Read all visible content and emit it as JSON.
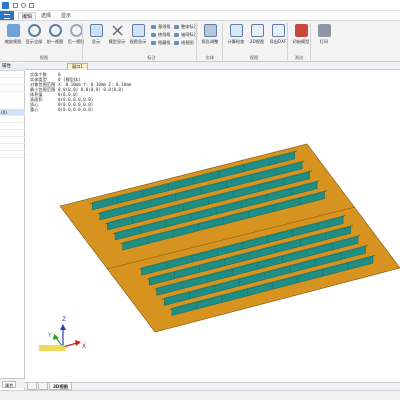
{
  "menu": {
    "tabs": [
      "编辑",
      "选择",
      "显示"
    ]
  },
  "ribbon": {
    "buttons": [
      {
        "label": "缩放视图",
        "icon": "zoom-fit-icon"
      },
      {
        "label": "显示全部",
        "icon": "show-all-icon"
      },
      {
        "label": "前一视图",
        "icon": "previous-view-icon"
      },
      {
        "label": "后一视图",
        "icon": "next-view-icon"
      },
      {
        "label": "显示",
        "icon": "display-icon"
      },
      {
        "label": "模型显示",
        "icon": "model-display-icon"
      },
      {
        "label": "视图显示",
        "icon": "view-display-icon"
      },
      {
        "label": "报告调整",
        "icon": "report-adjust-icon"
      },
      {
        "label": "计算检查",
        "icon": "calc-check-icon"
      },
      {
        "label": "2D视图",
        "icon": "view-2d-icon"
      },
      {
        "label": "导出DXF",
        "icon": "export-dxf-icon"
      },
      {
        "label": "初始模型",
        "icon": "initial-model-icon"
      },
      {
        "label": "打印",
        "icon": "print-icon"
      }
    ],
    "small_items": [
      "基线框",
      "整体标注",
      "棱线框",
      "轴网标注",
      "比例尺",
      "隐藏框",
      "坐标系",
      "线框图"
    ],
    "groups": [
      "视图",
      "标注",
      "实体",
      "视图",
      "测试"
    ]
  },
  "left_panel": {
    "title": "属性",
    "rows": [
      "",
      "",
      "",
      "(0)",
      "",
      "",
      "",
      "",
      "",
      "",
      "",
      ""
    ]
  },
  "bottom_left_tab": "属性",
  "view_tab": "窗口1",
  "info": [
    {
      "key": "实体个数",
      "value": "0"
    },
    {
      "key": "实体类型",
      "value": "0 (模型体)"
    },
    {
      "key": "对象包围范围",
      "value": "X: 0.10mm  Y: 0.10mm  Z: 0.10mm"
    },
    {
      "key": "最小包围范围",
      "value": "0.0(0,0) 0.0(0,0) 0.0(0,0)"
    },
    {
      "key": "体积值",
      "value": "0(0,0,0)"
    },
    {
      "key": "表面积",
      "value": "0(0.0,0.0,0.0)"
    },
    {
      "key": "质心",
      "value": "0(0.0,0.0,0.0)"
    },
    {
      "key": "重心",
      "value": "0(0.0,0.0,0.0)"
    }
  ],
  "axes": {
    "x": "X",
    "y": "Y",
    "z": "Z"
  },
  "bottom_tabs": [
    "",
    "",
    "3D视图"
  ],
  "colors": {
    "plate": "#d6931f",
    "stiffener": "#1f8f85",
    "accent": "#2e74c8"
  }
}
